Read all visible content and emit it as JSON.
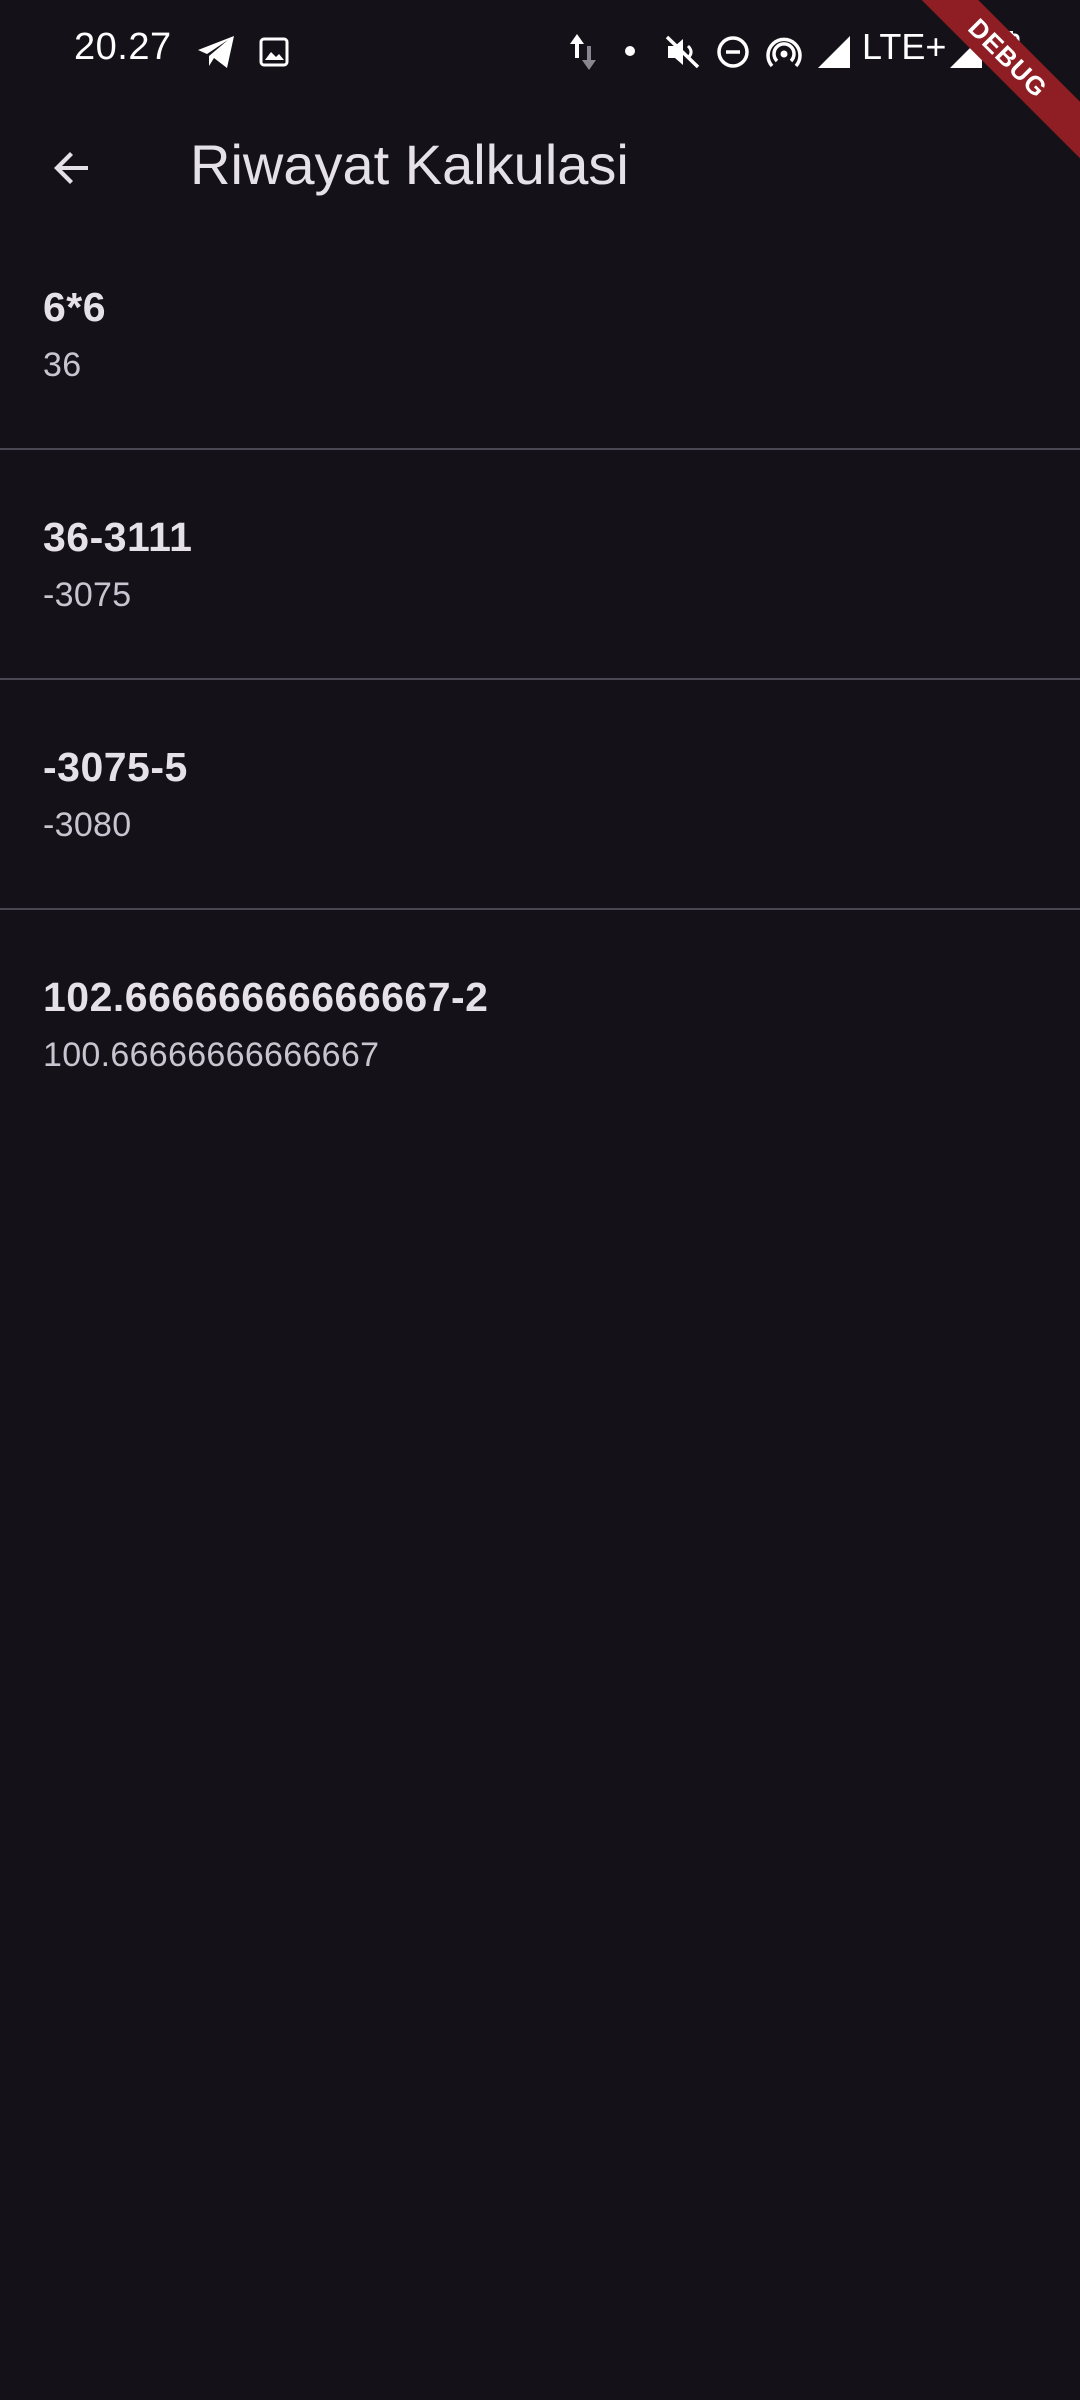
{
  "status_bar": {
    "time": "20.27",
    "network": "LTE+",
    "icons": [
      "telegram-icon",
      "image-icon",
      "data-transfer-icon",
      "dot-icon",
      "mute-icon",
      "do-not-disturb-icon",
      "hotspot-icon",
      "signal-icon",
      "signal-icon",
      "battery-icon"
    ]
  },
  "debug_banner": "DEBUG",
  "app_bar": {
    "title": "Riwayat Kalkulasi",
    "back_icon": "arrow-back-icon"
  },
  "history": [
    {
      "expression": "6*6",
      "result": "36"
    },
    {
      "expression": "36-3111",
      "result": "-3075"
    },
    {
      "expression": "-3075-5",
      "result": "-3080"
    },
    {
      "expression": "102.66666666666667-2",
      "result": "100.66666666666667"
    }
  ],
  "colors": {
    "background": "#141218",
    "text_primary": "#e6e0e9",
    "text_secondary": "#cac4d0",
    "divider": "#4a4652",
    "debug_banner": "#8e1e24"
  }
}
